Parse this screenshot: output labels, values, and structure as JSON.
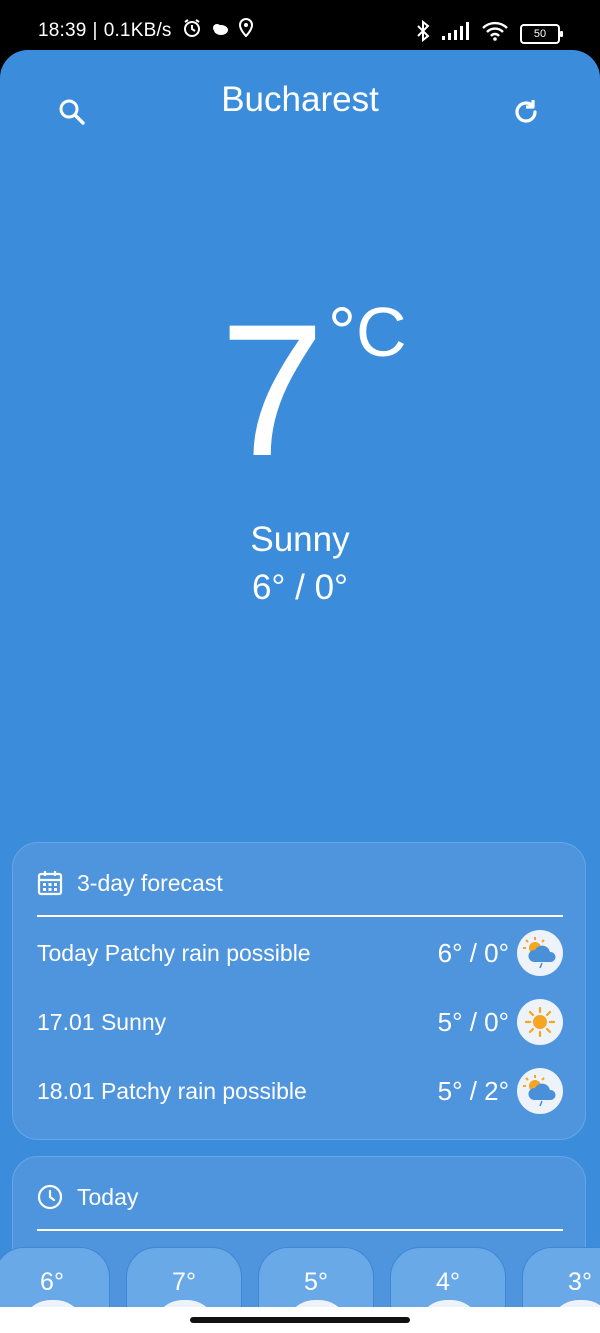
{
  "status_bar": {
    "time": "18:39",
    "speed": "0.1KB/s",
    "battery": "50",
    "icons": [
      "alarm-icon",
      "weather-icon",
      "location-icon",
      "bluetooth-icon",
      "signal-icon",
      "wifi-icon",
      "battery-icon"
    ]
  },
  "header": {
    "city": "Bucharest",
    "search_icon": "search-icon",
    "refresh_icon": "refresh-icon"
  },
  "current": {
    "temperature": "7",
    "unit": "°C",
    "condition": "Sunny",
    "high_low": "6° / 0°"
  },
  "forecast": {
    "title": "3-day forecast",
    "rows": [
      {
        "label": "Today Patchy rain possible",
        "temps": "6° / 0°",
        "icon": "patchy-rain-icon"
      },
      {
        "label": "17.01 Sunny",
        "temps": "5° / 0°",
        "icon": "sunny-icon"
      },
      {
        "label": "18.01 Patchy rain possible",
        "temps": "5° / 2°",
        "icon": "patchy-rain-icon"
      }
    ]
  },
  "today": {
    "title": "Today",
    "hours": [
      "6°",
      "7°",
      "5°",
      "4°",
      "3°"
    ]
  },
  "colors": {
    "background": "#3b8ddc",
    "card": "#4f95de",
    "text": "#ffffff"
  }
}
